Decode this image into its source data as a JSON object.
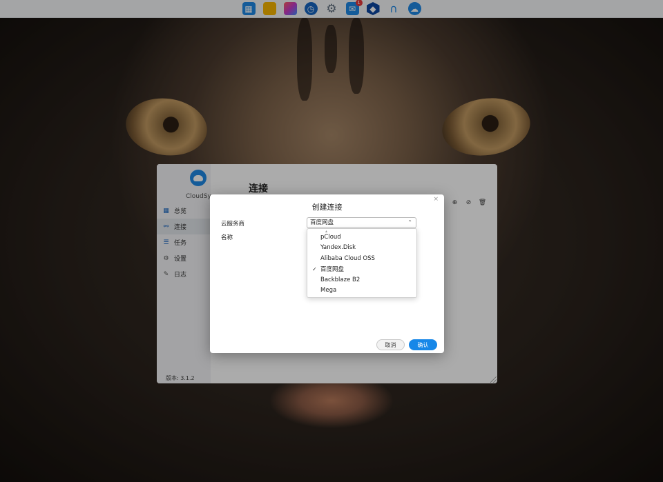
{
  "taskbar": {
    "icons": [
      {
        "name": "grid-app-icon",
        "color": "#1e88e5"
      },
      {
        "name": "folder-icon",
        "color": "#f7b500"
      },
      {
        "name": "photos-icon",
        "color": "#c43ac9"
      },
      {
        "name": "clock-icon",
        "color": "#1565c0"
      },
      {
        "name": "settings-gear-icon",
        "color": "#5b6b7b"
      },
      {
        "name": "mail-icon",
        "color": "#1e88e5",
        "badge": "1"
      },
      {
        "name": "shield-box-icon",
        "color": "#0d47a1"
      },
      {
        "name": "headset-icon",
        "color": "#1e88e5"
      },
      {
        "name": "cloudsync-icon",
        "color": "#1e88e5"
      }
    ]
  },
  "app": {
    "name": "CloudSync",
    "title": "连接",
    "version": "版本: 3.1.2",
    "nav": [
      {
        "label": "总览",
        "icon": "dashboard-icon",
        "active": false
      },
      {
        "label": "连接",
        "icon": "link-icon",
        "active": true
      },
      {
        "label": "任务",
        "icon": "task-list-icon",
        "active": false
      },
      {
        "label": "设置",
        "icon": "gear-icon",
        "active": false
      },
      {
        "label": "日志",
        "icon": "log-icon",
        "active": false
      }
    ],
    "toolbar_icons": [
      "add-circle-icon",
      "check-circle-icon",
      "trash-icon"
    ]
  },
  "dialog": {
    "title": "创建连接",
    "close": "×",
    "provider_label": "云服务商",
    "provider_value": "百度网盘",
    "name_label": "名称",
    "options": [
      "pCloud",
      "Yandex.Disk",
      "Alibaba Cloud OSS",
      "百度网盘",
      "Backblaze B2",
      "Mega"
    ],
    "selected_option": "百度网盘",
    "cancel_label": "取消",
    "confirm_label": "确认",
    "accent": "#1787e8"
  }
}
